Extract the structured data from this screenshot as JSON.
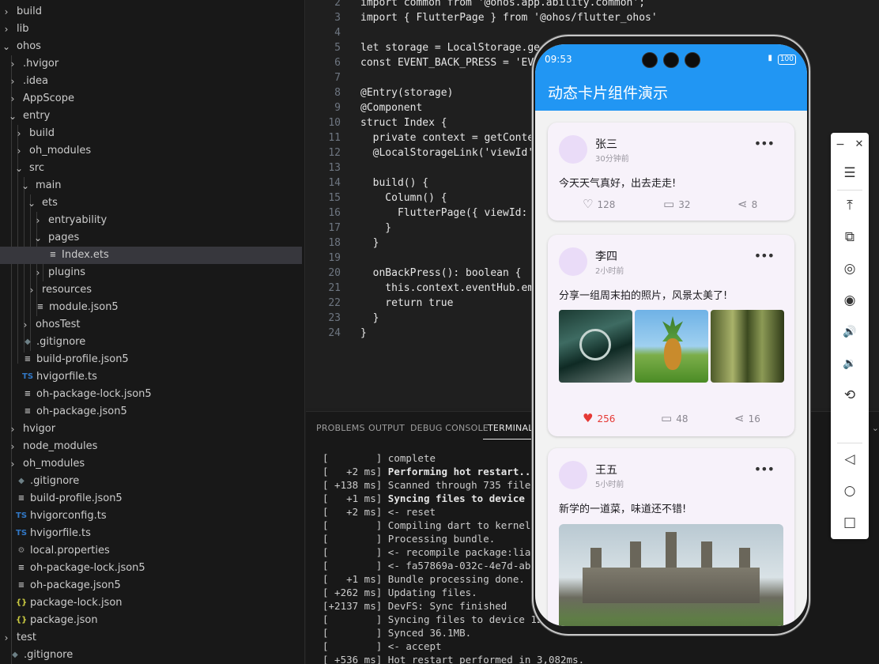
{
  "explorer": {
    "items": [
      {
        "label": "build",
        "chev": "›",
        "icon": ""
      },
      {
        "label": "lib",
        "chev": "›",
        "icon": ""
      },
      {
        "label": "ohos",
        "chev": "⌄",
        "icon": ""
      },
      {
        "label": ".hvigor",
        "chev": "›",
        "icon": ""
      },
      {
        "label": ".idea",
        "chev": "›",
        "icon": ""
      },
      {
        "label": "AppScope",
        "chev": "›",
        "icon": ""
      },
      {
        "label": "entry",
        "chev": "⌄",
        "icon": ""
      },
      {
        "label": "build",
        "chev": "›",
        "icon": ""
      },
      {
        "label": "oh_modules",
        "chev": "›",
        "icon": ""
      },
      {
        "label": "src",
        "chev": "⌄",
        "icon": ""
      },
      {
        "label": "main",
        "chev": "⌄",
        "icon": ""
      },
      {
        "label": "ets",
        "chev": "⌄",
        "icon": ""
      },
      {
        "label": "entryability",
        "chev": "›",
        "icon": ""
      },
      {
        "label": "pages",
        "chev": "⌄",
        "icon": ""
      },
      {
        "label": "Index.ets",
        "chev": "",
        "icon": "≡"
      },
      {
        "label": "plugins",
        "chev": "›",
        "icon": ""
      },
      {
        "label": "resources",
        "chev": "›",
        "icon": ""
      },
      {
        "label": "module.json5",
        "chev": "",
        "icon": "≡"
      },
      {
        "label": "ohosTest",
        "chev": "›",
        "icon": ""
      },
      {
        "label": ".gitignore",
        "chev": "",
        "icon": "◆"
      },
      {
        "label": "build-profile.json5",
        "chev": "",
        "icon": "≡"
      },
      {
        "label": "hvigorfile.ts",
        "chev": "",
        "icon": "TS"
      },
      {
        "label": "oh-package-lock.json5",
        "chev": "",
        "icon": "≡"
      },
      {
        "label": "oh-package.json5",
        "chev": "",
        "icon": "≡"
      },
      {
        "label": "hvigor",
        "chev": "›",
        "icon": ""
      },
      {
        "label": "node_modules",
        "chev": "›",
        "icon": ""
      },
      {
        "label": "oh_modules",
        "chev": "›",
        "icon": ""
      },
      {
        "label": ".gitignore",
        "chev": "",
        "icon": "◆"
      },
      {
        "label": "build-profile.json5",
        "chev": "",
        "icon": "≡"
      },
      {
        "label": "hvigorconfig.ts",
        "chev": "",
        "icon": "TS"
      },
      {
        "label": "hvigorfile.ts",
        "chev": "",
        "icon": "TS"
      },
      {
        "label": "local.properties",
        "chev": "",
        "icon": "⚙"
      },
      {
        "label": "oh-package-lock.json5",
        "chev": "",
        "icon": "≡"
      },
      {
        "label": "oh-package.json5",
        "chev": "",
        "icon": "≡"
      },
      {
        "label": "package-lock.json",
        "chev": "",
        "icon": "{}"
      },
      {
        "label": "package.json",
        "chev": "",
        "icon": "{}"
      },
      {
        "label": "test",
        "chev": "›",
        "icon": ""
      },
      {
        "label": ".gitignore",
        "chev": "",
        "icon": "◆"
      }
    ]
  },
  "editor": {
    "lines": [
      {
        "n": "2",
        "t": "import common from '@ohos.app.ability.common';"
      },
      {
        "n": "3",
        "t": "import { FlutterPage } from '@ohos/flutter_ohos'"
      },
      {
        "n": "4",
        "t": ""
      },
      {
        "n": "5",
        "t": "let storage = LocalStorage.ge"
      },
      {
        "n": "6",
        "t": "const EVENT_BACK_PRESS = 'EV"
      },
      {
        "n": "7",
        "t": ""
      },
      {
        "n": "8",
        "t": "@Entry(storage)"
      },
      {
        "n": "9",
        "t": "@Component"
      },
      {
        "n": "10",
        "t": "struct Index {"
      },
      {
        "n": "11",
        "t": "  private context = getContex"
      },
      {
        "n": "12",
        "t": "  @LocalStorageLink('viewId'"
      },
      {
        "n": "13",
        "t": ""
      },
      {
        "n": "14",
        "t": "  build() {"
      },
      {
        "n": "15",
        "t": "    Column() {"
      },
      {
        "n": "16",
        "t": "      FlutterPage({ viewId: "
      },
      {
        "n": "17",
        "t": "    }"
      },
      {
        "n": "18",
        "t": "  }"
      },
      {
        "n": "19",
        "t": ""
      },
      {
        "n": "20",
        "t": "  onBackPress(): boolean {"
      },
      {
        "n": "21",
        "t": "    this.context.eventHub.em"
      },
      {
        "n": "22",
        "t": "    return true"
      },
      {
        "n": "23",
        "t": "  }"
      },
      {
        "n": "24",
        "t": "}"
      }
    ]
  },
  "panel": {
    "tabs": [
      "PROBLEMS",
      "OUTPUT",
      "DEBUG CONSOLE",
      "TERMINAL"
    ],
    "active_tab": "TERMINAL",
    "terminal": [
      {
        "t": "[        ] ",
        "m": "complete",
        "b": false
      },
      {
        "t": "[   +2 ms] ",
        "m": "Performing hot restart...",
        "b": true
      },
      {
        "t": "[ +138 ms] ",
        "m": "Scanned through 735 files i",
        "b": false
      },
      {
        "t": "[   +1 ms] ",
        "m": "Syncing files to device 127",
        "b": true
      },
      {
        "t": "[   +2 ms] ",
        "m": "<- reset",
        "b": false
      },
      {
        "t": "[        ] ",
        "m": "Compiling dart to kernel wi",
        "b": false
      },
      {
        "t": "[        ] ",
        "m": "Processing bundle.",
        "b": false
      },
      {
        "t": "[        ] ",
        "m": "<- recompile package:lianxi",
        "b": false
      },
      {
        "t": "[        ] ",
        "m": "<- fa57869a-032c-4e7d-abc6-",
        "b": false
      },
      {
        "t": "[   +1 ms] ",
        "m": "Bundle processing done.",
        "b": false
      },
      {
        "t": "[ +262 ms] ",
        "m": "Updating files.",
        "b": false
      },
      {
        "t": "[+2137 ms] ",
        "m": "DevFS: Sync finished",
        "b": false
      },
      {
        "t": "[        ] ",
        "m": "Syncing files to device 127.",
        "b": false
      },
      {
        "t": "[        ] ",
        "m": "Synced 36.1MB.",
        "b": false
      },
      {
        "t": "[        ] ",
        "m": "<- accept",
        "b": false
      },
      {
        "t": "[ +536 ms] ",
        "m": "Hot restart performed in 3,082ms.",
        "b": false
      }
    ]
  },
  "emulator_toolbar": {
    "minimize": "−",
    "close": "✕",
    "menu": "☰",
    "buttons": [
      "⤒",
      "⧉",
      "◎",
      "◉",
      "🔊",
      "🔉",
      "⟲"
    ],
    "nav": [
      "◁",
      "○",
      "□"
    ]
  },
  "phone": {
    "status_time": "09:53",
    "battery": "100",
    "bolt": "▮",
    "app_title": "动态卡片组件演示",
    "posts": [
      {
        "user": "张三",
        "time": "30分钟前",
        "text": "今天天气真好，出去走走!",
        "likes": "128",
        "comments": "32",
        "shares": "8",
        "liked": false
      },
      {
        "user": "李四",
        "time": "2小时前",
        "text": "分享一组周末拍的照片，风景太美了!",
        "likes": "256",
        "comments": "48",
        "shares": "16",
        "liked": true
      },
      {
        "user": "王五",
        "time": "5小时前",
        "text": "新学的一道菜，味道还不错!"
      }
    ],
    "colors": {
      "primary": "#2196f3",
      "liked": "#e53935"
    }
  }
}
